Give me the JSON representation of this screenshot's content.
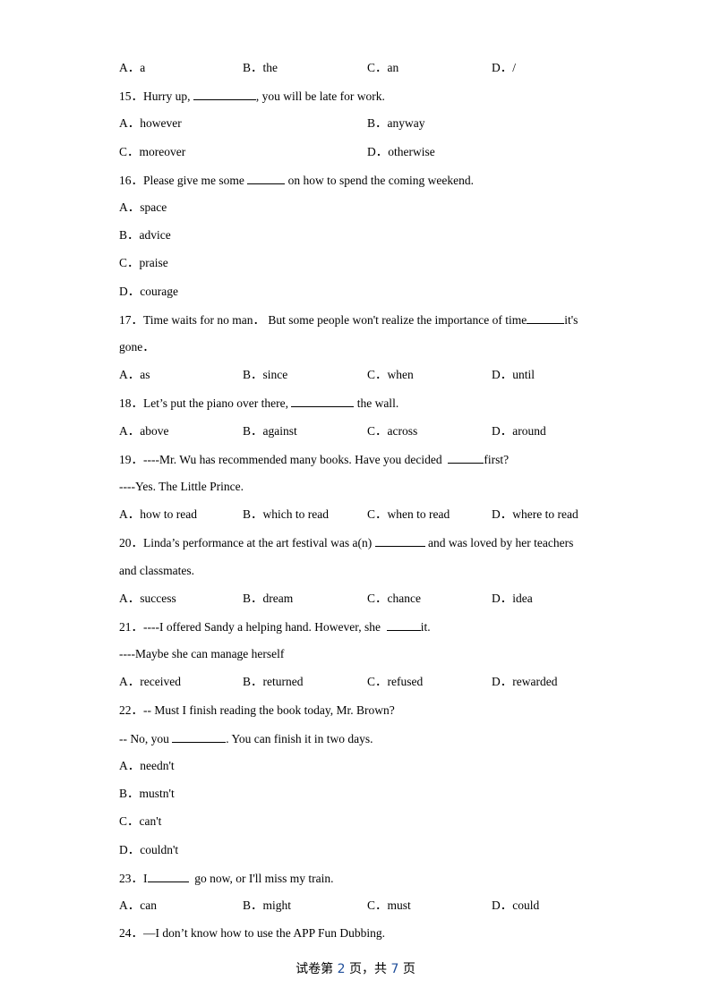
{
  "page": {
    "footer": {
      "prefix": "试卷第 ",
      "current": "2",
      "middle": " 页，共 ",
      "total": "7",
      "suffix": " 页"
    }
  },
  "q14": {
    "options": [
      "A．a",
      "B．the",
      "C．an",
      "D．/"
    ]
  },
  "q15": {
    "pre": "15．Hurry up, ",
    "post": ", you will be late for work.",
    "options": [
      "A．however",
      "B．anyway",
      "C．moreover",
      "D．otherwise"
    ]
  },
  "q16": {
    "pre": "16．Please give me some ",
    "post": " on how to spend the coming weekend.",
    "options": [
      "A．space",
      "B．advice",
      "C．praise",
      "D．courage"
    ]
  },
  "q17": {
    "pre": "17．Time waits for no man． But some people won't realize the importance of time",
    "post": "it's",
    "line2": "gone．",
    "options": [
      "A．as",
      "B．since",
      "C．when",
      "D．until"
    ]
  },
  "q18": {
    "pre": "18．Let’s put the piano over there, ",
    "post": " the wall.",
    "options": [
      "A．above",
      "B．against",
      "C．across",
      "D．around"
    ]
  },
  "q19": {
    "pre": "19．----Mr. Wu has recommended many books. Have you decided  ",
    "post": "first?",
    "line2": "----Yes. The Little Prince.",
    "options": [
      "A．how to read",
      "B．which to read",
      "C．when to read",
      "D．where to read"
    ]
  },
  "q20": {
    "pre": "20．Linda’s performance at the art festival was a(n) ",
    "post": " and was loved by her teachers",
    "line2": "and classmates.",
    "options": [
      "A．success",
      "B．dream",
      "C．chance",
      "D．idea"
    ]
  },
  "q21": {
    "pre": "21．----I offered Sandy a helping hand. However, she  ",
    "post": "it.",
    "line2": "----Maybe she can manage herself",
    "options": [
      "A．received",
      "B．returned",
      "C．refused",
      "D．rewarded"
    ]
  },
  "q22": {
    "line1": "22．-- Must I finish reading the book today, Mr. Brown?",
    "pre": "-- No, you ",
    "post": ". You can finish it in two days.",
    "options": [
      "A．needn't",
      "B．mustn't",
      "C．can't",
      "D．couldn't"
    ]
  },
  "q23": {
    "pre": "23．I",
    "post": "  go now, or I'll miss my train.",
    "options": [
      "A．can",
      "B．might",
      "C．must",
      "D．could"
    ]
  },
  "q24": {
    "line1": "24．—I don’t know how to use the APP Fun Dubbing."
  }
}
